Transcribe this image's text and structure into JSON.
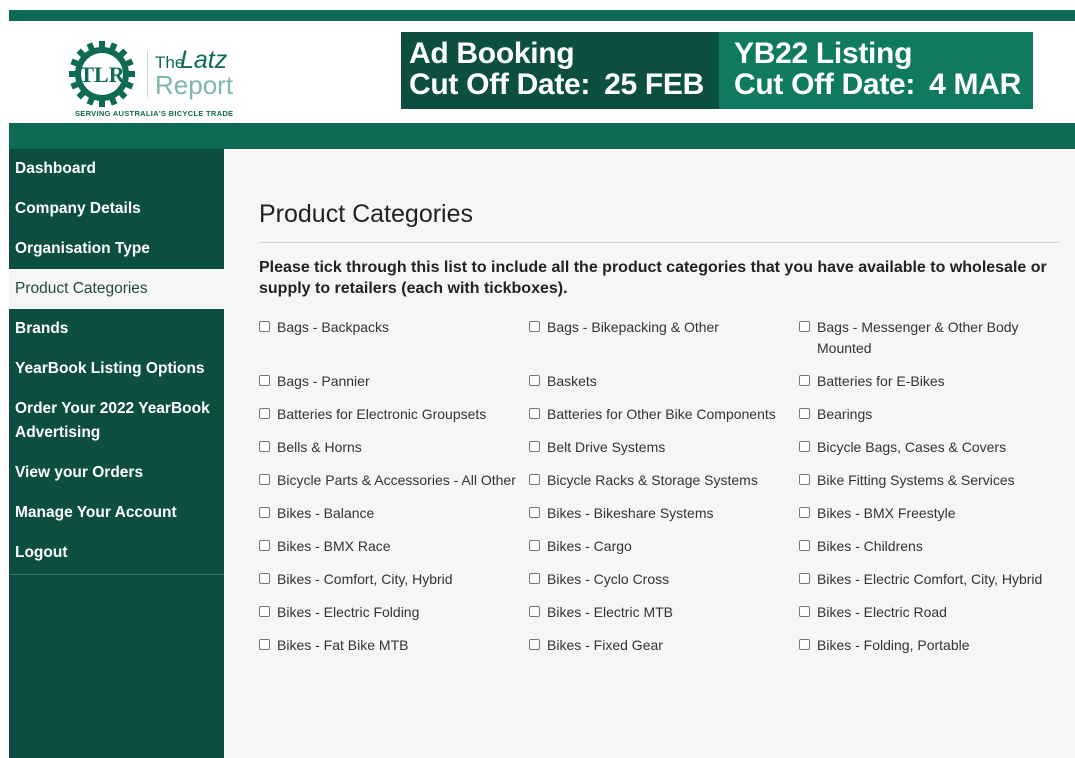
{
  "header": {
    "logo": {
      "initials": "TLR",
      "the": "The",
      "latz": "Latz",
      "report": "Report",
      "tagline": "SERVING AUSTRALIA'S BICYCLE TRADE"
    },
    "banner": {
      "left_line1": "Ad Booking",
      "left_line2": "Cut Off Date:",
      "left_date": "25 FEB",
      "right_line1": "YB22 Listing",
      "right_line2": "Cut Off Date:",
      "right_date": "4 MAR"
    }
  },
  "sidebar": {
    "items": [
      {
        "label": "Dashboard"
      },
      {
        "label": "Company Details"
      },
      {
        "label": "Organisation Type"
      },
      {
        "label": "Product Categories",
        "active": true
      },
      {
        "label": "Brands"
      },
      {
        "label": "YearBook Listing Options"
      },
      {
        "label": "Order Your 2022 YearBook Advertising"
      },
      {
        "label": "View your Orders"
      },
      {
        "label": "Manage Your Account"
      },
      {
        "label": "Logout"
      }
    ]
  },
  "main": {
    "title": "Product Categories",
    "intro": "Please tick through this list to include all the product categories that you have available to wholesale or supply to retailers (each with tickboxes).",
    "categories": [
      "Bags - Backpacks",
      "Bags - Bikepacking & Other",
      "Bags - Messenger & Other Body Mounted",
      "Bags - Pannier",
      "Baskets",
      "Batteries for E-Bikes",
      "Batteries for Electronic Groupsets",
      "Batteries for Other Bike Components",
      "Bearings",
      "Bells & Horns",
      "Belt Drive Systems",
      "Bicycle Bags, Cases & Covers",
      "Bicycle Parts & Accessories - All Other",
      "Bicycle Racks & Storage Systems",
      "Bike Fitting Systems & Services",
      "Bikes - Balance",
      "Bikes - Bikeshare Systems",
      "Bikes - BMX Freestyle",
      "Bikes - BMX Race",
      "Bikes - Cargo",
      "Bikes - Childrens",
      "Bikes - Comfort, City, Hybrid",
      "Bikes - Cyclo Cross",
      "Bikes - Electric Comfort, City, Hybrid",
      "Bikes - Electric Folding",
      "Bikes - Electric MTB",
      "Bikes - Electric Road",
      "Bikes - Fat Bike MTB",
      "Bikes - Fixed Gear",
      "Bikes - Folding, Portable"
    ]
  },
  "colors": {
    "brand_dark": "#0c4f40",
    "brand": "#0f6a55",
    "brand_light": "#0f7a5f",
    "content_bg": "#f6f6f6"
  }
}
